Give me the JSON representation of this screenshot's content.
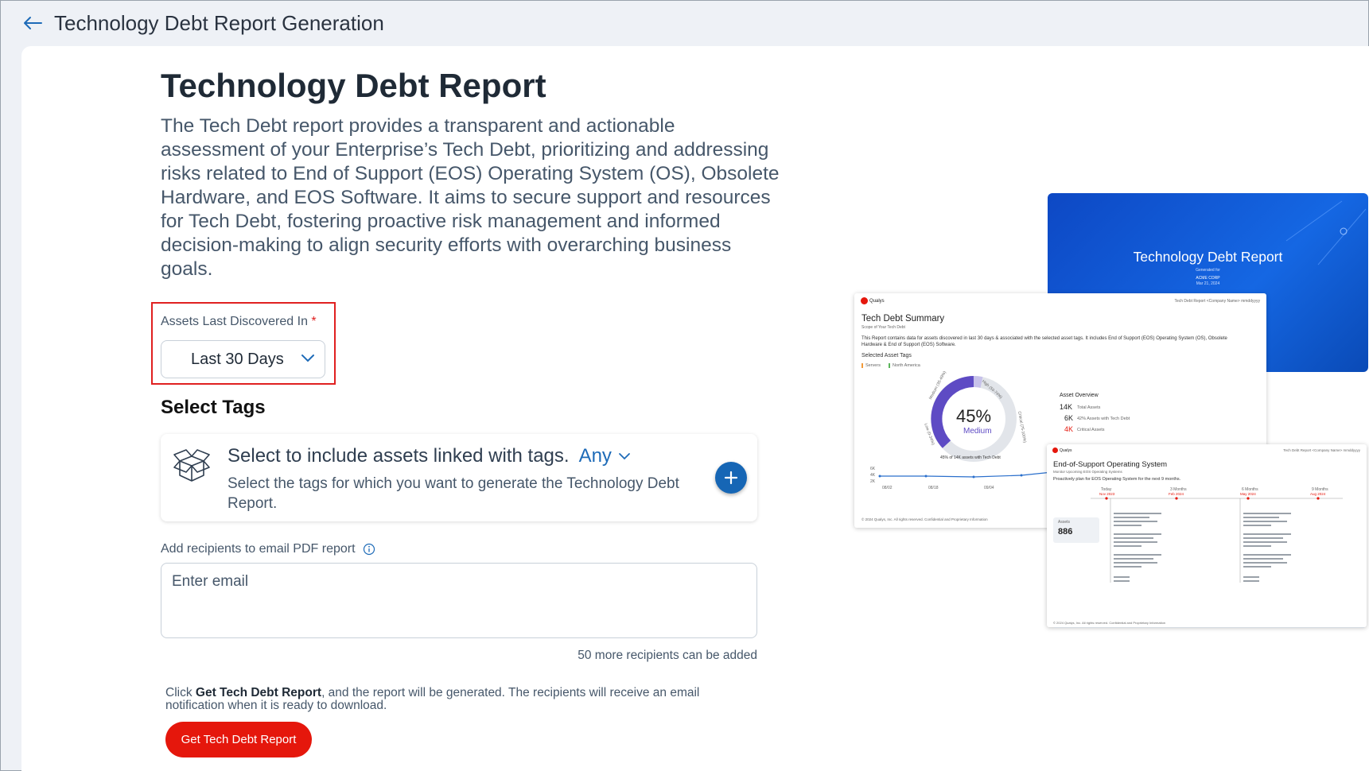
{
  "header": {
    "title": "Technology Debt Report Generation",
    "back_icon": "arrow-left-icon"
  },
  "main": {
    "title": "Technology Debt Report",
    "description": "The Tech Debt report provides a transparent and actionable assessment of your Enterprise’s Tech Debt, prioritizing and addressing risks related to End of Support (EOS) Operating System (OS), Obsolete Hardware, and EOS Software. It aims to secure support and resources for Tech Debt, fostering proactive risk management and informed decision-making to align security efforts with overarching business goals.",
    "assets_field": {
      "label": "Assets Last Discovered In",
      "required_mark": "*",
      "selected": "Last 30 Days"
    },
    "tags": {
      "section_title": "Select Tags",
      "headline": "Select to include assets linked with tags.",
      "match_mode": "Any",
      "helper": "Select the tags for which you want to generate the Technology Debt Report."
    },
    "recipients": {
      "label": "Add recipients to email PDF report",
      "placeholder": "Enter email",
      "remaining": "50 more recipients can be added"
    },
    "footer": {
      "note_prefix": "Click ",
      "note_bold": "Get Tech Debt Report",
      "note_suffix": ", and the report will be generated. The recipients will receive an email notification when it is ready to download.",
      "button_label": "Get Tech Debt Report"
    }
  },
  "preview": {
    "cover": {
      "title": "Technology Debt Report",
      "generated_for": "Generated for",
      "company": "ACME CORP",
      "date": "Mar 21, 2024"
    },
    "summary_page": {
      "logo": "Qualys",
      "header_right": "Tech Debt Report <Company Name> mmddyyyy",
      "title": "Tech Debt Summary",
      "subtitle": "Scope of Your Tech Debt",
      "intro": "This Report contains data for assets discovered in last 30 days & associated with the selected asset tags. It includes End of Support (EOS) Operating System (OS), Obsolete Hardware & End of Support (EOS) Software.",
      "tags_label": "Selected Asset Tags",
      "tags": [
        "Servers",
        "North America"
      ],
      "gauge_value": "45%",
      "gauge_label": "Medium",
      "gauge_medium": "Medium (35-49%)",
      "gauge_high": "High (50-74%)",
      "gauge_critical": "Critical (75-100%)",
      "gauge_low": "Low (0-34%)",
      "gauge_caption": "45% of 14K assets with Tech Debt",
      "overview_title": "Asset Overview",
      "overview": [
        {
          "value": "14K",
          "label": "Total Assets"
        },
        {
          "value": "6K",
          "label": "42% Assets with Tech Debt"
        },
        {
          "value": "4K",
          "label": "Critical Assets"
        }
      ],
      "chart_y": [
        "6K",
        "4K",
        "2K"
      ],
      "chart_x": [
        "08/02",
        "08/18",
        "09/04"
      ],
      "footer": "© 2024 Qualys, Inc. All rights reserved. Confidential and Proprietary Information"
    },
    "eos_page": {
      "logo": "Qualys",
      "header_right": "Tech Debt Report <Company Name> mmddyyyy",
      "title": "End-of-Support Operating System",
      "subtitle": "Monitor Upcoming EOS Operating Systems",
      "plan": "Proactively plan for EOS Operating System for the next 9 months.",
      "timeline": [
        "Today",
        "3 Months",
        "6 Months",
        "9 Months"
      ],
      "timeline_dates": [
        "Nov 2023",
        "Feb 2024",
        "May 2024",
        "Aug 2024"
      ],
      "assets_label": "Assets",
      "assets_value": "886",
      "footer": "© 2024 Qualys, Inc. All rights reserved. Confidential and Proprietary Information"
    }
  }
}
